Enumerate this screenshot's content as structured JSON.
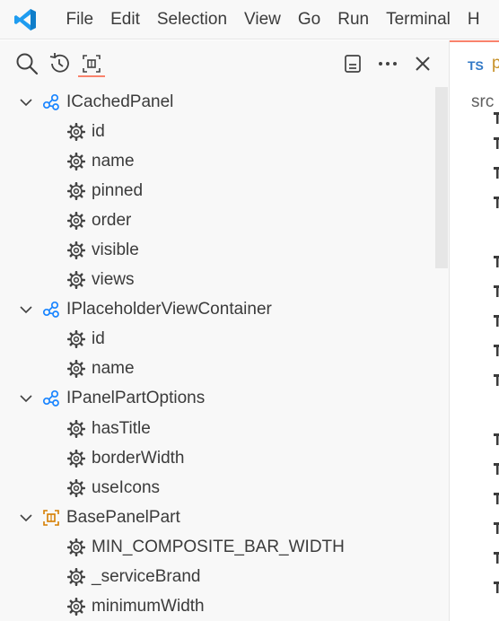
{
  "menubar": {
    "items": [
      "File",
      "Edit",
      "Selection",
      "View",
      "Go",
      "Run",
      "Terminal",
      "H"
    ]
  },
  "outline": {
    "nodes": [
      {
        "label": "ICachedPanel",
        "kind": "interface",
        "expanded": true,
        "children": [
          "id",
          "name",
          "pinned",
          "order",
          "visible",
          "views"
        ]
      },
      {
        "label": "IPlaceholderViewContainer",
        "kind": "interface",
        "expanded": true,
        "children": [
          "id",
          "name"
        ]
      },
      {
        "label": "IPanelPartOptions",
        "kind": "interface",
        "expanded": true,
        "children": [
          "hasTitle",
          "borderWidth",
          "useIcons"
        ]
      },
      {
        "label": "BasePanelPart",
        "kind": "class",
        "expanded": true,
        "children": [
          "MIN_COMPOSITE_BAR_WIDTH",
          "_serviceBrand",
          "minimumWidth"
        ]
      }
    ]
  },
  "editor": {
    "tab_language_badge": "TS",
    "tab_name": "p",
    "breadcrumb": "src"
  },
  "colors": {
    "accent": "#f9826c",
    "interface_icon": "#1a85ff",
    "class_icon": "#d67e00",
    "vscode_logo": "#23a9f2"
  }
}
